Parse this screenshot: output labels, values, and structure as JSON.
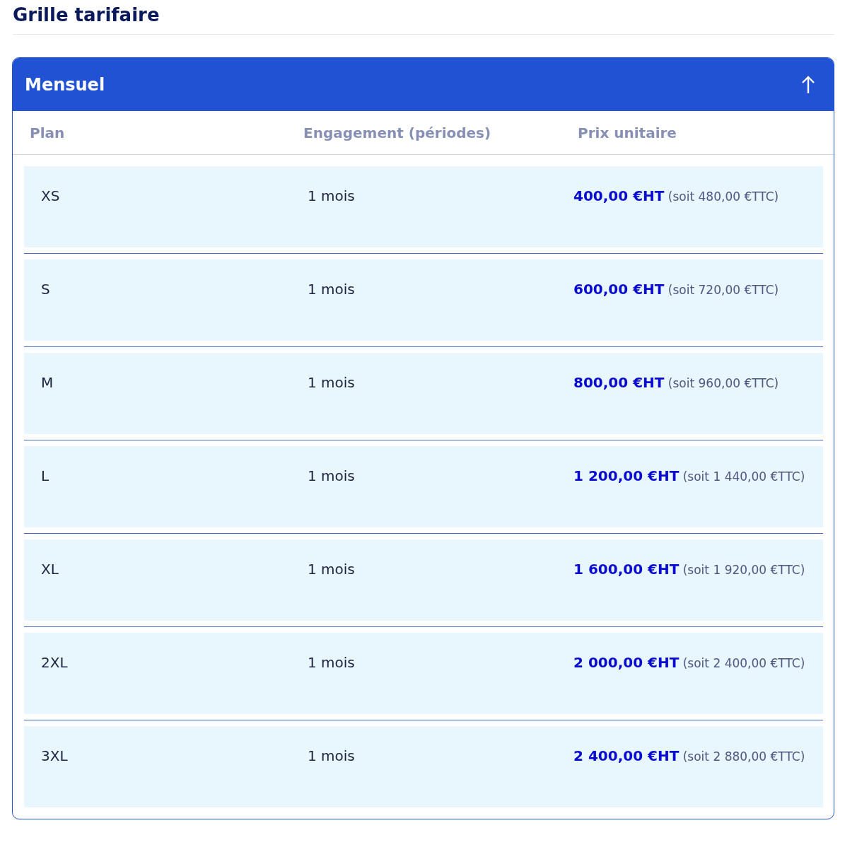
{
  "title": "Grille tarifaire",
  "panel": {
    "title": "Mensuel",
    "expanded": true,
    "columns": [
      "Plan",
      "Engagement (périodes)",
      "Prix unitaire"
    ],
    "rows": [
      {
        "plan": "XS",
        "engagement": "1 mois",
        "price": "**400,00 €HT** (soit 480,00 €TTC)"
      },
      {
        "plan": "S",
        "engagement": "1 mois",
        "price": "**600,00 €HT** (soit 720,00 €TTC)"
      },
      {
        "plan": "M",
        "engagement": "1 mois",
        "price": "**800,00 €HT** (soit 960,00 €TTC)"
      },
      {
        "plan": "L",
        "engagement": "1 mois",
        "price": "**1 200,00 €HT** (soit 1 440,00 €TTC)"
      },
      {
        "plan": "XL",
        "engagement": "1 mois",
        "price": "**1 600,00 €HT** (soit 1 920,00 €TTC)"
      },
      {
        "plan": "2XL",
        "engagement": "1 mois",
        "price": "**2 000,00 €HT** (soit 2 400,00 €TTC)"
      },
      {
        "plan": "3XL",
        "engagement": "1 mois",
        "price": "**2 400,00 €HT** (soit 2 880,00 €TTC)"
      }
    ]
  }
}
